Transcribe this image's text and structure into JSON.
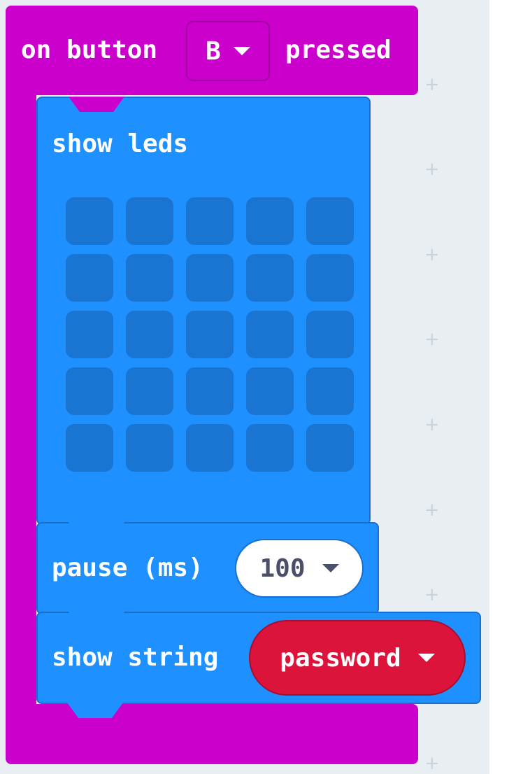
{
  "event_block": {
    "prefix": "on button",
    "button_value": "B",
    "suffix": "pressed",
    "color": "#cc00cc"
  },
  "show_leds": {
    "label": "show leds",
    "color": "#1e90ff",
    "leds": [
      [
        0,
        0,
        0,
        0,
        0
      ],
      [
        0,
        0,
        0,
        0,
        0
      ],
      [
        0,
        0,
        0,
        0,
        0
      ],
      [
        0,
        0,
        0,
        0,
        0
      ],
      [
        0,
        0,
        0,
        0,
        0
      ]
    ]
  },
  "pause": {
    "label": "pause (ms)",
    "value": "100"
  },
  "show_string": {
    "label": "show string",
    "value": "password",
    "color": "#dc143c"
  }
}
